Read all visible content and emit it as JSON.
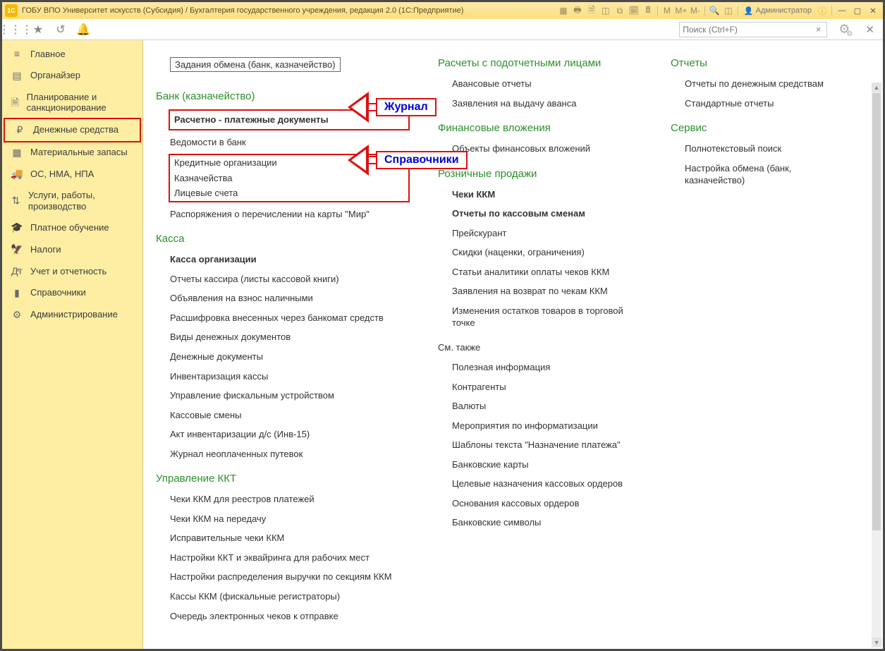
{
  "titlebar": {
    "title": "ГОБУ ВПО Университет искусств (Субсидия) / Бухгалтерия государственного учреждения, редакция 2.0  (1С:Предприятие)",
    "user": "Администратор",
    "icons": {
      "m": "M",
      "mplus": "M+",
      "mminus": "M-"
    }
  },
  "toolbar": {
    "search_placeholder": "Поиск (Ctrl+F)"
  },
  "sidebar": {
    "items": [
      {
        "label": "Главное"
      },
      {
        "label": "Органайзер"
      },
      {
        "label": "Планирование и санкционирование"
      },
      {
        "label": "Денежные средства"
      },
      {
        "label": "Материальные запасы"
      },
      {
        "label": "ОС, НМА, НПА"
      },
      {
        "label": "Услуги, работы, производство"
      },
      {
        "label": "Платное обучение"
      },
      {
        "label": "Налоги"
      },
      {
        "label": "Учет и отчетность"
      },
      {
        "label": "Справочники"
      },
      {
        "label": "Администрирование"
      }
    ]
  },
  "callouts": {
    "journal": "Журнал",
    "references": "Справочники"
  },
  "col1": {
    "boxed": "Задания обмена (банк, казначейство)",
    "bank_title": "Банк (казначейство)",
    "bank": [
      "Расчетно - платежные документы",
      "Ведомости в банк",
      "Кредитные организации",
      "Казначейства",
      "Лицевые счета",
      "Распоряжения о перечислении на карты \"Мир\""
    ],
    "kassa_title": "Касса",
    "kassa": [
      "Касса организации",
      "Отчеты кассира (листы кассовой книги)",
      "Объявления на взнос наличными",
      "Расшифровка внесенных через банкомат средств",
      "Виды денежных документов",
      "Денежные документы",
      "Инвентаризация кассы",
      "Управление фискальным устройством",
      "Кассовые смены",
      "Акт инвентаризации д/с (Инв-15)",
      "Журнал неоплаченных путевок"
    ],
    "kkt_title": "Управление ККТ",
    "kkt": [
      "Чеки ККМ для реестров платежей",
      "Чеки ККМ на передачу",
      "Исправительные чеки ККМ",
      "Настройки ККТ и эквайринга для рабочих мест",
      "Настройки распределения выручки по секциям ККМ",
      "Кассы ККМ (фискальные регистраторы)",
      "Очередь электронных чеков к отправке"
    ]
  },
  "col2": {
    "pod_title": "Расчеты с подотчетными лицами",
    "pod": [
      "Авансовые отчеты",
      "Заявления на выдачу аванса"
    ],
    "fin_title": "Финансовые вложения",
    "fin": [
      "Объекты финансовых вложений"
    ],
    "roz_title": "Розничные продажи",
    "roz": [
      "Чеки ККМ",
      "Отчеты по кассовым сменам",
      "Прейскурант",
      "Скидки (наценки, ограничения)",
      "Статьи аналитики оплаты чеков ККМ",
      "Заявления на возврат по чекам ККМ",
      "Изменения остатков товаров в торговой точке"
    ],
    "see_title": "См. также",
    "see": [
      "Полезная информация",
      "Контрагенты",
      "Валюты",
      "Мероприятия по информатизации",
      "Шаблоны текста \"Назначение платежа\"",
      "Банковские карты",
      "Целевые назначения кассовых ордеров",
      "Основания кассовых ордеров",
      "Банковские символы"
    ]
  },
  "col3": {
    "rep_title": "Отчеты",
    "rep": [
      "Отчеты по денежным средствам",
      "Стандартные отчеты"
    ],
    "srv_title": "Сервис",
    "srv": [
      "Полнотекстовый поиск",
      "Настройка обмена (банк, казначейство)"
    ]
  }
}
